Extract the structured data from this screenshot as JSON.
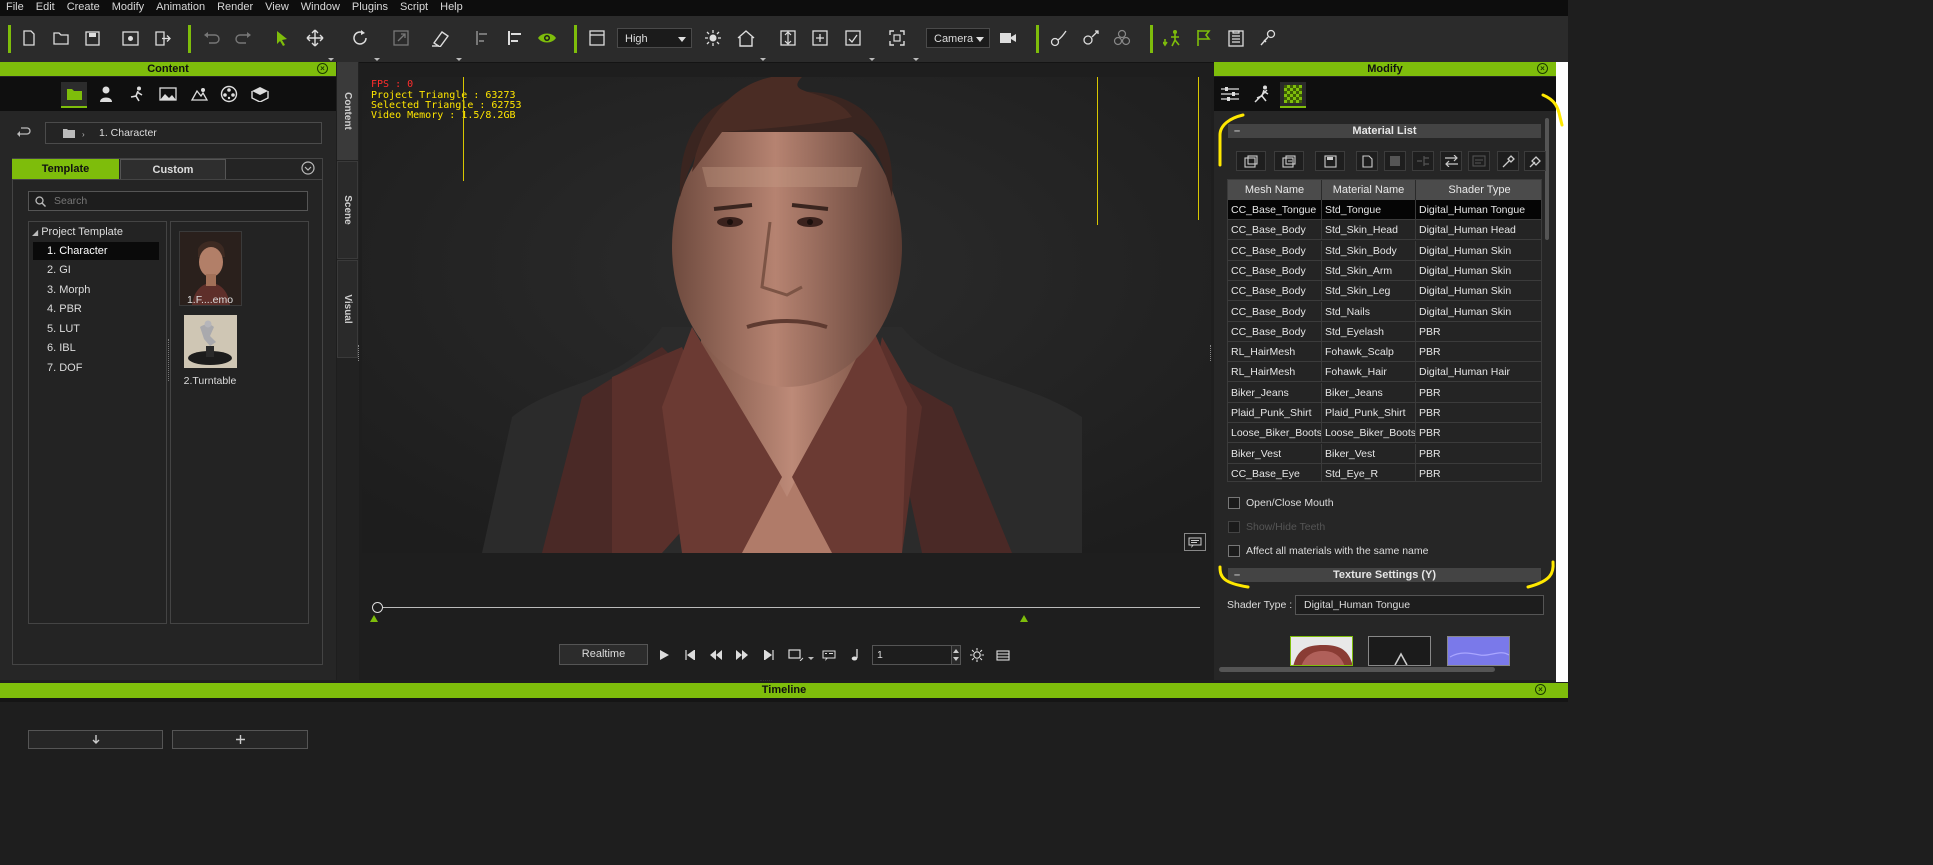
{
  "menu": [
    "File",
    "Edit",
    "Create",
    "Modify",
    "Animation",
    "Render",
    "View",
    "Window",
    "Plugins",
    "Script",
    "Help"
  ],
  "toolbar": {
    "quality_value": "High",
    "camera_value": "Camera",
    "accent": "#7ebd0b"
  },
  "content_panel": {
    "title": "Content",
    "path": "1. Character",
    "tabs": [
      "Template",
      "Custom"
    ],
    "search_placeholder": "Search",
    "tree_root": "Project Template",
    "tree_items": [
      "1. Character",
      "2. GI",
      "3. Morph",
      "4. PBR",
      "5. LUT",
      "6. IBL",
      "7. DOF"
    ],
    "thumbnails": [
      "1.F....emo",
      "2.Turntable"
    ]
  },
  "vertical_tabs": [
    "Content",
    "Scene",
    "Visual"
  ],
  "viewport": {
    "fps": "FPS : 0",
    "project_triangle": "Project Triangle : 63273",
    "selected_triangle": "Selected Triangle : 62753",
    "video_memory": "Video Memory : 1.5/8.2GB"
  },
  "playback": {
    "mode": "Realtime",
    "frame": "1"
  },
  "modify_panel": {
    "title": "Modify",
    "material_list_title": "Material List",
    "columns": [
      "Mesh Name",
      "Material Name",
      "Shader Type"
    ],
    "rows": [
      [
        "CC_Base_Tongue",
        "Std_Tongue",
        "Digital_Human Tongue"
      ],
      [
        "CC_Base_Body",
        "Std_Skin_Head",
        "Digital_Human Head"
      ],
      [
        "CC_Base_Body",
        "Std_Skin_Body",
        "Digital_Human Skin"
      ],
      [
        "CC_Base_Body",
        "Std_Skin_Arm",
        "Digital_Human Skin"
      ],
      [
        "CC_Base_Body",
        "Std_Skin_Leg",
        "Digital_Human Skin"
      ],
      [
        "CC_Base_Body",
        "Std_Nails",
        "Digital_Human Skin"
      ],
      [
        "CC_Base_Body",
        "Std_Eyelash",
        "PBR"
      ],
      [
        "RL_HairMesh",
        "Fohawk_Scalp",
        "PBR"
      ],
      [
        "RL_HairMesh",
        "Fohawk_Hair",
        "Digital_Human Hair"
      ],
      [
        "Biker_Jeans",
        "Biker_Jeans",
        "PBR"
      ],
      [
        "Plaid_Punk_Shirt",
        "Plaid_Punk_Shirt",
        "PBR"
      ],
      [
        "Loose_Biker_Boots",
        "Loose_Biker_Boots",
        "PBR"
      ],
      [
        "Biker_Vest",
        "Biker_Vest",
        "PBR"
      ],
      [
        "CC_Base_Eye",
        "Std_Eye_R",
        "PBR"
      ]
    ],
    "open_close_mouth": "Open/Close Mouth",
    "show_hide_teeth": "Show/Hide Teeth",
    "affect_all": "Affect all materials with the same name",
    "texture_settings_title": "Texture Settings  (Y)",
    "shader_type_label": "Shader Type :",
    "shader_type_value": "Digital_Human Tongue"
  },
  "timeline": {
    "title": "Timeline"
  }
}
